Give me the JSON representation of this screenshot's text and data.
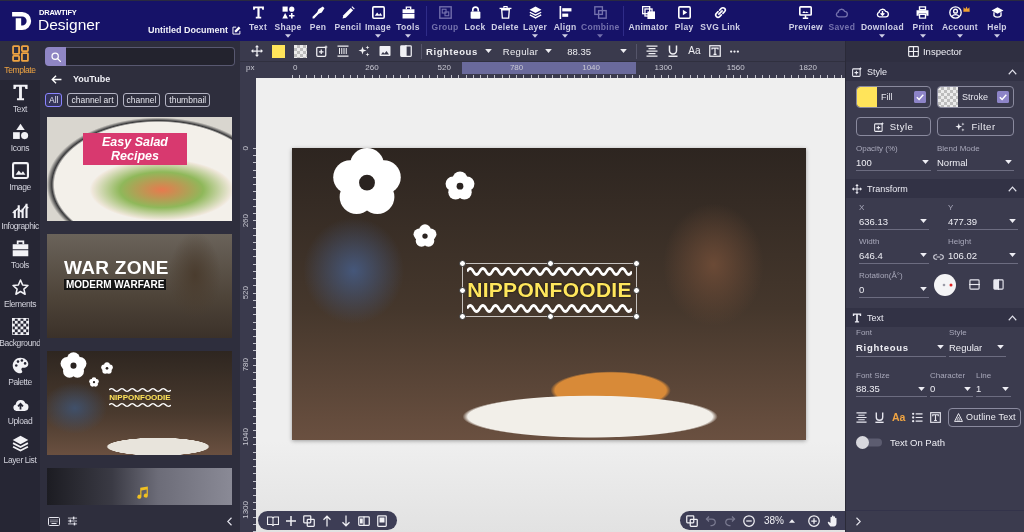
{
  "header": {
    "brand_small": "DRAWTIFY",
    "brand": "Designer",
    "document_title": "Untitled Document"
  },
  "toolbar": [
    {
      "items": [
        {
          "label": "Text",
          "has_menu": false,
          "disabled": false
        },
        {
          "label": "Shape",
          "has_menu": true,
          "disabled": false
        },
        {
          "label": "Pen",
          "has_menu": false,
          "disabled": false
        },
        {
          "label": "Pencil",
          "has_menu": false,
          "disabled": false
        },
        {
          "label": "Image",
          "has_menu": true,
          "disabled": false
        },
        {
          "label": "Tools",
          "has_menu": true,
          "disabled": false
        }
      ]
    },
    {
      "items": [
        {
          "label": "Group",
          "has_menu": false,
          "disabled": true
        },
        {
          "label": "Lock",
          "has_menu": false,
          "disabled": false
        },
        {
          "label": "Delete",
          "has_menu": false,
          "disabled": false
        },
        {
          "label": "Layer",
          "has_menu": true,
          "disabled": false
        },
        {
          "label": "Align",
          "has_menu": true,
          "disabled": false
        },
        {
          "label": "Combine",
          "has_menu": true,
          "disabled": true
        }
      ]
    },
    {
      "items": [
        {
          "label": "Animator",
          "has_menu": false,
          "disabled": false
        },
        {
          "label": "Play",
          "has_menu": false,
          "disabled": false
        },
        {
          "label": "SVG Link",
          "has_menu": false,
          "disabled": false
        }
      ]
    }
  ],
  "actions": [
    {
      "label": "Preview",
      "has_menu": false,
      "disabled": false
    },
    {
      "label": "Saved",
      "has_menu": false,
      "disabled": true
    },
    {
      "label": "Download",
      "has_menu": true,
      "disabled": false
    },
    {
      "label": "Print",
      "has_menu": true,
      "disabled": false
    },
    {
      "label": "Account",
      "has_menu": true,
      "disabled": false
    },
    {
      "label": "Help",
      "has_menu": true,
      "disabled": false
    }
  ],
  "sidebar": {
    "items": [
      {
        "label": "Template",
        "selected": true
      },
      {
        "label": "Text",
        "selected": false
      },
      {
        "label": "Icons",
        "selected": false
      },
      {
        "label": "Image",
        "selected": false
      },
      {
        "label": "Infographic",
        "selected": false
      },
      {
        "label": "Tools",
        "selected": false
      },
      {
        "label": "Elements",
        "selected": false
      },
      {
        "label": "Background",
        "selected": false
      },
      {
        "label": "Palette",
        "selected": false
      },
      {
        "label": "Upload",
        "selected": false
      },
      {
        "label": "Layer List",
        "selected": false
      }
    ]
  },
  "template_panel": {
    "category": "YouTube",
    "filters": [
      {
        "label": "All",
        "selected": true
      },
      {
        "label": "channel art",
        "selected": false
      },
      {
        "label": "channel",
        "selected": false
      },
      {
        "label": "thumbnail",
        "selected": false
      }
    ],
    "templates": [
      {
        "kind": "salad",
        "title": "Easy Salad Recipes"
      },
      {
        "kind": "war",
        "title": "WAR ZONE",
        "subtitle": "MODERM WARFARE"
      },
      {
        "kind": "sushi",
        "title": "NIPPONFOODIE"
      },
      {
        "kind": "music"
      }
    ]
  },
  "format_bar": {
    "font": "Righteous",
    "style": "Regular",
    "size": "88.35",
    "case_label": "Aa"
  },
  "rulers": {
    "unit": "px",
    "horizontal": [
      "0",
      "260",
      "520",
      "780",
      "1040",
      "1300",
      "1560",
      "1820"
    ],
    "vertical": [
      "0",
      "260",
      "520",
      "780",
      "1040",
      "1300"
    ]
  },
  "canvas": {
    "headline": "NIPPONFOODIE",
    "selected": true
  },
  "zoom_bar": {
    "zoom": "38%",
    "undo_disabled": true,
    "redo_disabled": true
  },
  "inspector": {
    "title": "Inspector",
    "style": {
      "title": "Style",
      "expanded": true,
      "fill": {
        "label": "Fill",
        "checked": true
      },
      "stroke": {
        "label": "Stroke",
        "checked": true
      },
      "style_button": "Style",
      "filter_button": "Filter",
      "opacity": {
        "label": "Opacity (%)",
        "value": "100"
      },
      "blend_mode": {
        "label": "Blend Mode",
        "value": "Normal"
      }
    },
    "transform": {
      "title": "Transform",
      "expanded": true,
      "x": {
        "label": "X",
        "value": "636.13"
      },
      "y": {
        "label": "Y",
        "value": "477.39"
      },
      "width": {
        "label": "Width",
        "value": "646.4"
      },
      "height": {
        "label": "Height",
        "value": "106.02"
      },
      "rotation": {
        "label": "Rotation(Å°)",
        "value": "0"
      }
    },
    "text": {
      "title": "Text",
      "expanded": true,
      "font": {
        "label": "Font",
        "value": "Righteous"
      },
      "style": {
        "label": "Style",
        "value": "Regular"
      },
      "font_size": {
        "label": "Font Size",
        "value": "88.35"
      },
      "character": {
        "label": "Character",
        "value": "0"
      },
      "line": {
        "label": "Line",
        "value": "1"
      },
      "case_label": "Aa",
      "outline_button": "Outline Text",
      "text_on_path": {
        "label": "Text On Path",
        "on": false
      }
    }
  }
}
